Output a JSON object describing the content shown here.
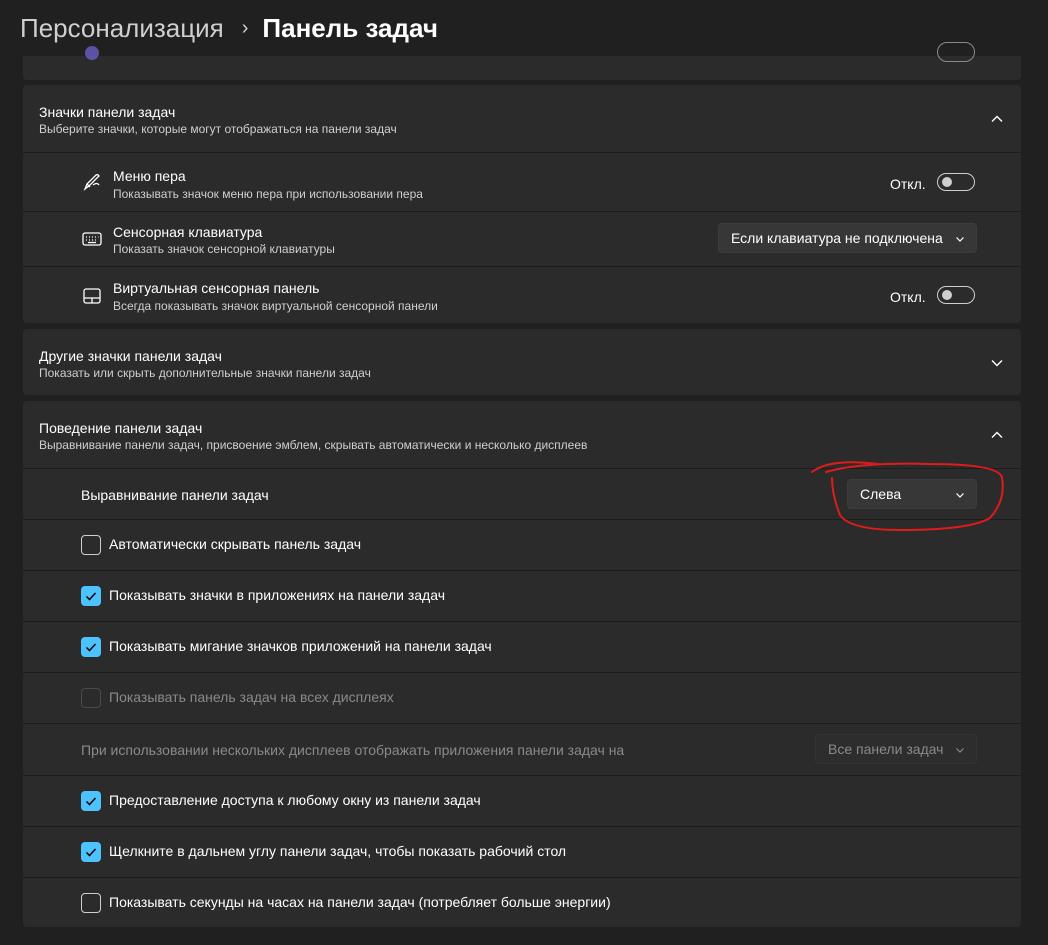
{
  "breadcrumb": {
    "parent": "Персонализация",
    "separator": "›",
    "current": "Панель задач"
  },
  "taskbar_icons": {
    "title": "Значки панели задач",
    "subtitle": "Выберите значки, которые могут отображаться на панели задач",
    "expanded": true,
    "items": [
      {
        "icon": "pen-icon",
        "title": "Меню пера",
        "subtitle": "Показывать значок меню пера при использовании пера",
        "control": "toggle",
        "state_label": "Откл.",
        "on": false
      },
      {
        "icon": "keyboard-icon",
        "title": "Сенсорная клавиатура",
        "subtitle": "Показать значок сенсорной клавиатуры",
        "control": "dropdown",
        "value": "Если клавиатура не подключена"
      },
      {
        "icon": "touchpad-icon",
        "title": "Виртуальная сенсорная панель",
        "subtitle": "Всегда показывать значок виртуальной сенсорной панели",
        "control": "toggle",
        "state_label": "Откл.",
        "on": false
      }
    ]
  },
  "other_icons": {
    "title": "Другие значки панели задач",
    "subtitle": "Показать или скрыть дополнительные значки панели задач",
    "expanded": false
  },
  "behavior": {
    "title": "Поведение панели задач",
    "subtitle": "Выравнивание панели задач, присвоение эмблем, скрывать автоматически и несколько дисплеев",
    "expanded": true,
    "alignment": {
      "label": "Выравнивание панели задач",
      "value": "Слева"
    },
    "checkboxes": [
      {
        "label": "Автоматически скрывать панель задач",
        "checked": false,
        "disabled": false
      },
      {
        "label": "Показывать значки в приложениях на панели задач",
        "checked": true,
        "disabled": false
      },
      {
        "label": "Показывать мигание значков приложений на панели задач",
        "checked": true,
        "disabled": false
      },
      {
        "label": "Показывать панель задач на всех дисплеях",
        "checked": false,
        "disabled": true
      }
    ],
    "multi_display": {
      "label": "При использовании нескольких дисплеев отображать приложения панели задач на",
      "value": "Все панели задач",
      "disabled": true
    },
    "checkboxes2": [
      {
        "label": "Предоставление доступа к любому окну из панели задач",
        "checked": true,
        "disabled": false
      },
      {
        "label": "Щелкните в дальнем углу панели задач, чтобы показать рабочий стол",
        "checked": true,
        "disabled": false
      },
      {
        "label": "Показывать секунды на часах на панели задач (потребляет больше энергии)",
        "checked": false,
        "disabled": false
      }
    ]
  },
  "colors": {
    "background": "#202020",
    "card": "#2b2b2b",
    "accent": "#4cc2ff",
    "annotation": "#e01b1b"
  }
}
